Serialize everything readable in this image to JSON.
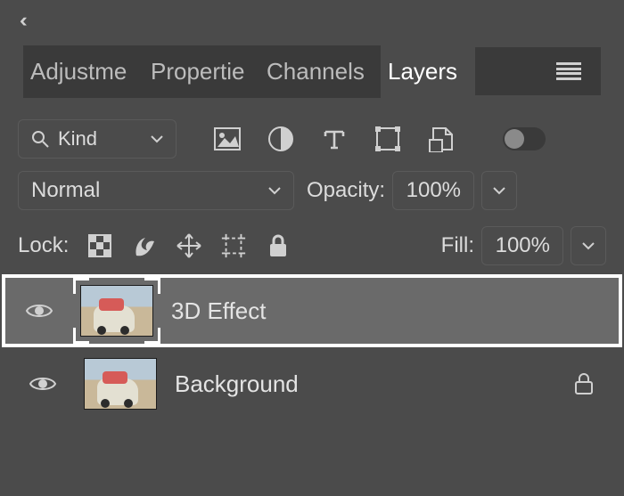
{
  "tabs": {
    "adjustments": "Adjustme",
    "properties": "Propertie",
    "channels": "Channels",
    "layers": "Layers"
  },
  "filter": {
    "kind_label": "Kind"
  },
  "blend": {
    "mode": "Normal",
    "opacity_label": "Opacity:",
    "opacity_value": "100%"
  },
  "lock": {
    "label": "Lock:",
    "fill_label": "Fill:",
    "fill_value": "100%"
  },
  "layers": [
    {
      "name": "3D Effect",
      "selected": true,
      "locked": false
    },
    {
      "name": "Background",
      "selected": false,
      "locked": true
    }
  ]
}
